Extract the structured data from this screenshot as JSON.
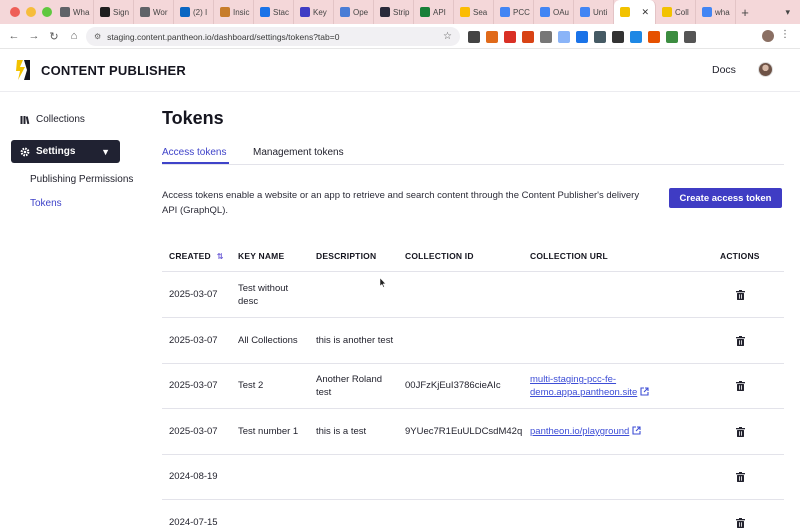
{
  "browser": {
    "tabs": [
      {
        "label": "Wha",
        "icon": "globe-icon",
        "color": "#5f6368"
      },
      {
        "label": "Sign",
        "icon": "github-icon",
        "color": "#1f1f1f"
      },
      {
        "label": "Wor",
        "icon": "globe-icon",
        "color": "#5f6368"
      },
      {
        "label": "(2) I",
        "icon": "linkedin-icon",
        "color": "#0a66c2"
      },
      {
        "label": "Insic",
        "icon": "flame-icon",
        "color": "#c77d2b"
      },
      {
        "label": "Stac",
        "icon": "stack-icon",
        "color": "#1a73e8"
      },
      {
        "label": "Key",
        "icon": "key-icon",
        "color": "#3f3cc4"
      },
      {
        "label": "Ope",
        "icon": "globe-icon",
        "color": "#4a7dd6"
      },
      {
        "label": "Strip",
        "icon": "stripe-icon",
        "color": "#2a2a3a"
      },
      {
        "label": "API",
        "icon": "sheet-icon",
        "color": "#188038"
      },
      {
        "label": "Sea",
        "icon": "drive-icon",
        "color": "#fbbc04"
      },
      {
        "label": "PCC",
        "icon": "doc-icon",
        "color": "#4285f4"
      },
      {
        "label": "OAu",
        "icon": "google-icon",
        "color": "#4285f4"
      },
      {
        "label": "Unti",
        "icon": "doc-icon",
        "color": "#4285f4"
      },
      {
        "label": "",
        "icon": "pantheon-icon",
        "color": "#f2c200",
        "active": true
      },
      {
        "label": "Coll",
        "icon": "pantheon-icon",
        "color": "#f2c200"
      },
      {
        "label": "wha",
        "icon": "google-icon",
        "color": "#4285f4"
      }
    ],
    "url": "staging.content.pantheon.io/dashboard/settings/tokens?tab=0",
    "extension_colors": [
      "#444",
      "#e06a1a",
      "#d93025",
      "#d84315",
      "#777",
      "#8ab4f8",
      "#1a73e8",
      "#455a64",
      "#333",
      "#1e88e5",
      "#e65100",
      "#3c8d40",
      "#555"
    ]
  },
  "app": {
    "brand": "CONTENT PUBLISHER",
    "docs_label": "Docs"
  },
  "sidebar": {
    "collections_label": "Collections",
    "settings_label": "Settings",
    "sub_items": [
      "Publishing Permissions",
      "Tokens"
    ]
  },
  "main": {
    "title": "Tokens",
    "tabs": [
      "Access tokens",
      "Management tokens"
    ],
    "description": "Access tokens enable a website or an app to retrieve and search content through the Content Publisher's delivery API (GraphQL).",
    "create_button": "Create access token"
  },
  "table": {
    "columns": [
      "CREATED",
      "KEY NAME",
      "DESCRIPTION",
      "COLLECTION ID",
      "COLLECTION URL",
      "ACTIONS"
    ],
    "rows": [
      {
        "created": "2025-03-07",
        "key_name": "Test without desc",
        "description": "",
        "collection_id": "",
        "collection_url": ""
      },
      {
        "created": "2025-03-07",
        "key_name": "All Collections",
        "description": "this is another test",
        "collection_id": "",
        "collection_url": ""
      },
      {
        "created": "2025-03-07",
        "key_name": "Test 2",
        "description": "Another Roland test",
        "collection_id": "00JFzKjEuI3786cieAIc",
        "collection_url": "multi-staging-pcc-fe-demo.appa.pantheon.site"
      },
      {
        "created": "2025-03-07",
        "key_name": "Test number 1",
        "description": "this is a test",
        "collection_id": "9YUec7R1EuULDCsdM42q",
        "collection_url": "pantheon.io/playground"
      },
      {
        "created": "2024-08-19",
        "key_name": "",
        "description": "",
        "collection_id": "",
        "collection_url": ""
      },
      {
        "created": "2024-07-15",
        "key_name": "",
        "description": "",
        "collection_id": "",
        "collection_url": ""
      }
    ]
  },
  "colors": {
    "accent": "#3f3cc4",
    "link": "#3d4dd6",
    "sidebar_active_bg": "#202232"
  }
}
